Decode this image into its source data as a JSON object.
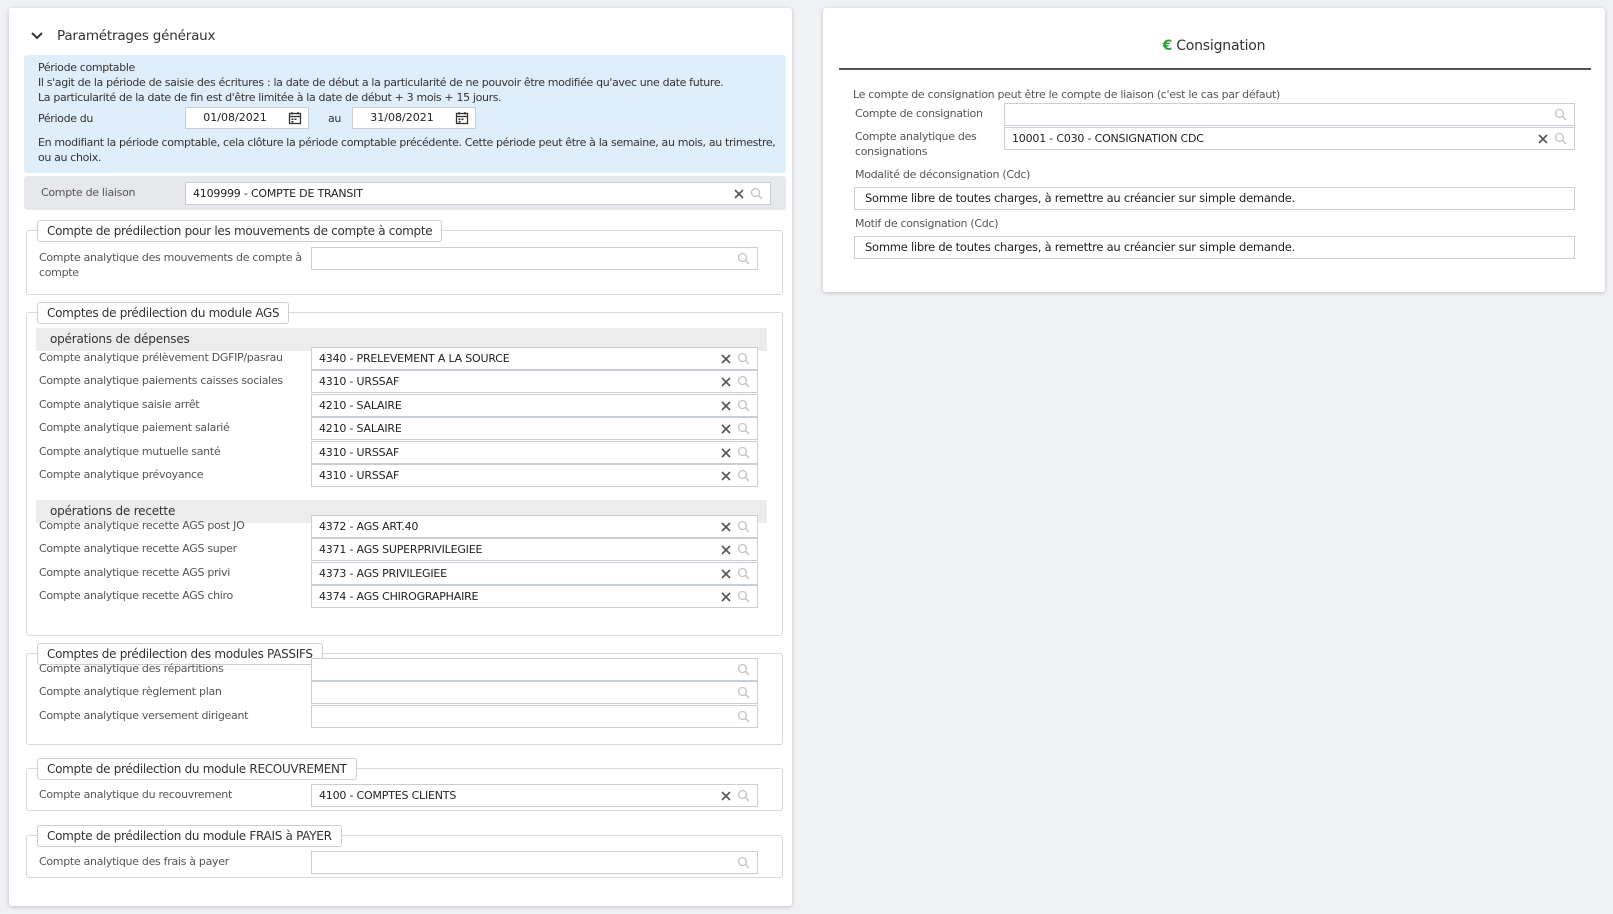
{
  "left": {
    "header_title": "Paramétrages généraux",
    "info": {
      "line1": "Période comptable",
      "line2": "Il s'agit de la période de saisie des écritures : la date de début a la particularité de ne pouvoir être modifiée qu'avec une date future.",
      "line3": "La particularité de la date de fin est d'être limitée à la date de début + 3 mois + 15 jours.",
      "period_label": "Période du",
      "date_from": "01/08/2021",
      "au_label": "au",
      "date_to": "31/08/2021",
      "note1": "En modifiant la période comptable, cela clôture la période comptable précédente. Cette période peut être à la semaine, au mois, au trimestre,",
      "note2": "ou au choix."
    },
    "liaison": {
      "label": "Compte de liaison",
      "value": "4109999 - COMPTE DE TRANSIT"
    },
    "compte_a_compte": {
      "legend": "Compte de prédilection pour les mouvements de compte à compte",
      "label1": "Compte analytique des mouvements de compte à",
      "label2": "compte",
      "value": ""
    },
    "ags": {
      "legend": "Comptes de prédilection du module AGS",
      "depenses_title": "opérations de dépenses",
      "depenses": [
        {
          "label": "Compte analytique prélèvement DGFIP/pasrau",
          "value": "4340 - PRELEVEMENT A LA SOURCE"
        },
        {
          "label": "Compte analytique paiements caisses sociales",
          "value": "4310 - URSSAF"
        },
        {
          "label": "Compte analytique saisie arrêt",
          "value": "4210 - SALAIRE"
        },
        {
          "label": "Compte analytique paiement salarié",
          "value": "4210 - SALAIRE"
        },
        {
          "label": "Compte analytique mutuelle santé",
          "value": "4310 - URSSAF"
        },
        {
          "label": "Compte analytique prévoyance",
          "value": "4310 - URSSAF"
        }
      ],
      "recette_title": "opérations de recette",
      "recettes": [
        {
          "label": "Compte analytique recette AGS post JO",
          "value": "4372 - AGS ART.40"
        },
        {
          "label": "Compte analytique recette AGS super",
          "value": "4371 - AGS SUPERPRIVILEGIEE"
        },
        {
          "label": "Compte analytique recette AGS privi",
          "value": "4373 - AGS PRIVILEGIEE"
        },
        {
          "label": "Compte analytique recette AGS chiro",
          "value": "4374 - AGS CHIROGRAPHAIRE"
        }
      ]
    },
    "passifs": {
      "legend": "Comptes de prédilection des modules PASSIFS",
      "rows": [
        {
          "label": "Compte analytique des répartitions",
          "value": ""
        },
        {
          "label": "Compte analytique règlement plan",
          "value": ""
        },
        {
          "label": "Compte analytique versement dirigeant",
          "value": ""
        }
      ]
    },
    "recouvrement": {
      "legend": "Compte de prédilection du module RECOUVREMENT",
      "label": "Compte analytique du recouvrement",
      "value": "4100 - COMPTES CLIENTS"
    },
    "frais": {
      "legend": "Compte de prédilection du module FRAIS à PAYER",
      "label": "Compte analytique des frais à payer",
      "value": ""
    }
  },
  "right": {
    "title": "Consignation",
    "euro_symbol": "€",
    "intro": "Le compte de consignation peut être le compte de liaison (c'est le cas par défaut)",
    "compte_label": "Compte de consignation",
    "compte_value": "",
    "analytique_label1": "Compte analytique des",
    "analytique_label2": "consignations",
    "analytique_value": "10001 - C030 - CONSIGNATION CDC",
    "modalite_label": "Modalité de déconsignation (Cdc)",
    "modalite_value": "Somme libre de toutes charges, à remettre au créancier sur simple demande.",
    "motif_label": "Motif de consignation (Cdc)",
    "motif_value": "Somme libre de toutes charges, à remettre au créancier sur simple demande."
  },
  "colors": {
    "info_bg": "#dfeefb",
    "euro": "#2e9e3a",
    "row_bg": "#e6e8eb"
  }
}
